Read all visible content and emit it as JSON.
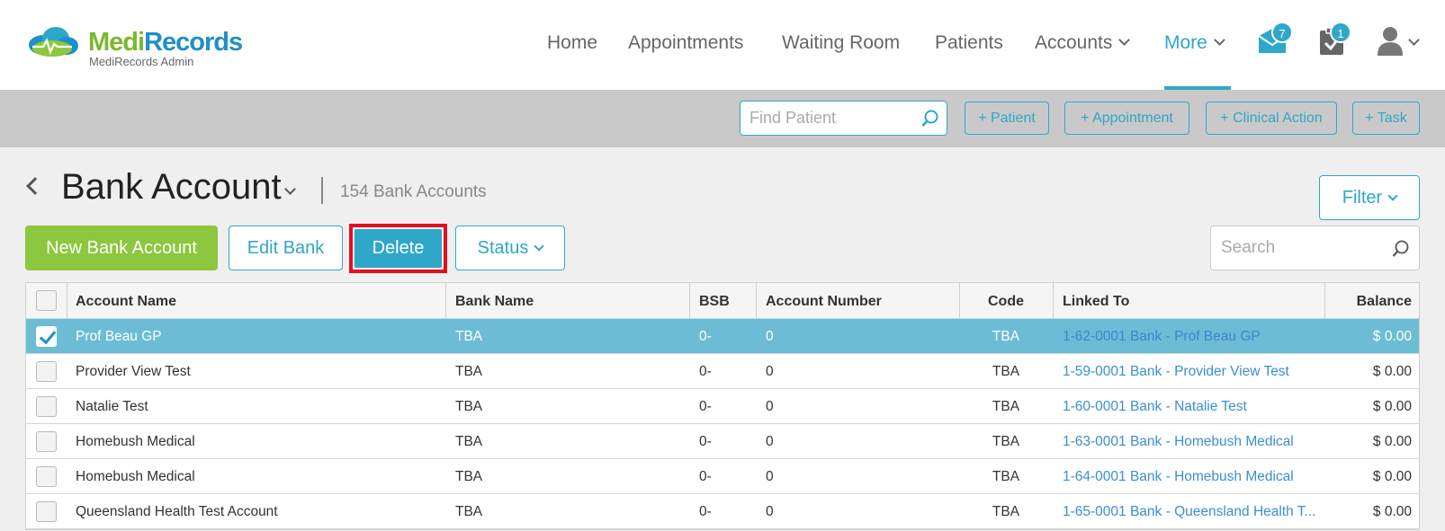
{
  "app": {
    "logo_name_part1": "Medi",
    "logo_name_part2": "Records",
    "logo_sub": "MediRecords Admin"
  },
  "nav": {
    "home": "Home",
    "appointments": "Appointments",
    "waiting_room": "Waiting Room",
    "patients": "Patients",
    "accounts": "Accounts",
    "more": "More",
    "messages_badge": "7",
    "tasks_badge": "1"
  },
  "actions": {
    "find_placeholder": "Find Patient",
    "add_patient": "+ Patient",
    "add_appointment": "+ Appointment",
    "add_clinical_action": "+ Clinical Action",
    "add_task": "+ Task"
  },
  "page": {
    "title": "Bank Account",
    "count": "154 Bank Accounts",
    "filter_label": "Filter",
    "new_label": "New Bank Account",
    "edit_label": "Edit Bank",
    "delete_label": "Delete",
    "status_label": "Status",
    "search_placeholder": "Search"
  },
  "table": {
    "headers": {
      "account_name": "Account Name",
      "bank_name": "Bank Name",
      "bsb": "BSB",
      "account_number": "Account Number",
      "code": "Code",
      "linked_to": "Linked To",
      "balance": "Balance"
    },
    "rows": [
      {
        "account_name": "Prof Beau GP",
        "bank_name": "TBA",
        "bsb": "0-",
        "account_number": "0",
        "code": "TBA",
        "linked_to": "1-62-0001 Bank - Prof Beau GP",
        "balance": "$ 0.00",
        "selected": true
      },
      {
        "account_name": "Provider View Test",
        "bank_name": "TBA",
        "bsb": "0-",
        "account_number": "0",
        "code": "TBA",
        "linked_to": "1-59-0001 Bank - Provider View Test",
        "balance": "$ 0.00",
        "selected": false
      },
      {
        "account_name": "Natalie Test",
        "bank_name": "TBA",
        "bsb": "0-",
        "account_number": "0",
        "code": "TBA",
        "linked_to": "1-60-0001 Bank - Natalie Test",
        "balance": "$ 0.00",
        "selected": false
      },
      {
        "account_name": "Homebush Medical",
        "bank_name": "TBA",
        "bsb": "0-",
        "account_number": "0",
        "code": "TBA",
        "linked_to": "1-63-0001 Bank - Homebush Medical",
        "balance": "$ 0.00",
        "selected": false
      },
      {
        "account_name": "Homebush Medical",
        "bank_name": "TBA",
        "bsb": "0-",
        "account_number": "0",
        "code": "TBA",
        "linked_to": "1-64-0001 Bank - Homebush Medical",
        "balance": "$ 0.00",
        "selected": false
      },
      {
        "account_name": "Queensland Health Test Account",
        "bank_name": "TBA",
        "bsb": "0-",
        "account_number": "0",
        "code": "TBA",
        "linked_to": "1-65-0001 Bank - Queensland Health T...",
        "balance": "$ 0.00",
        "selected": false
      }
    ]
  },
  "colors": {
    "accent": "#2fa7c9",
    "brand_green": "#7ab82e",
    "brand_blue": "#1f8fc7",
    "selected_row": "#6cbcd6",
    "highlight_border": "#e01020"
  }
}
